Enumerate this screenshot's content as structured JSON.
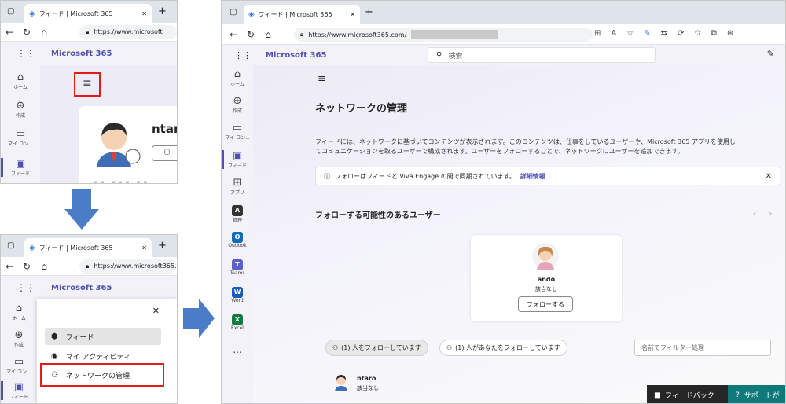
{
  "colors": {
    "accent": "#4f52b2",
    "highlight_box": "#e31b1b",
    "arrow": "#4a7cc7",
    "teams": "#5b5fc7",
    "outlook": "#0f6cbd",
    "word": "#185abd",
    "excel": "#107c41"
  },
  "browser": {
    "tab_title": "フィード | Microsoft 365",
    "url_prefix": "https://",
    "url_short": "www.microsoft",
    "url_mid": "www.microsoft365.c",
    "url_full": "www.microsoft365.com/"
  },
  "app": {
    "brand": "Microsoft 365",
    "search_placeholder": "検索"
  },
  "rail": {
    "home": "ホーム",
    "create": "作成",
    "mycontent_short": "マイ コン...",
    "mycontent": "マイ コン...",
    "feed": "フィード",
    "apps": "アプリ",
    "admin": "管理",
    "outlook": "Outlook",
    "teams": "Teams",
    "word": "Word",
    "excel": "Excel",
    "more": "..."
  },
  "panel1": {
    "profile_name": "ntar"
  },
  "panel2": {
    "menu_items": [
      {
        "label": "フィード"
      },
      {
        "label": "マイ アクティビティ"
      },
      {
        "label": "ネットワークの管理"
      }
    ]
  },
  "main": {
    "title": "ネットワークの管理",
    "description_line1": "フィードには、ネットワークに基づいてコンテンツが表示されます。このコンテンツは、仕事をしているユーザーや、Microsoft 365 アプリを使用し",
    "description_line2": "てコミュニケーションを取るユーザーで構成されます。ユーザーをフォローすることで、ネットワークにユーザーを追加できます。",
    "info_text": "フォローはフィードと Viva Engage の間で同期されています。",
    "info_link": "詳細情報",
    "suggestions_title": "フォローする可能性のあるユーザー",
    "suggestion": {
      "name": "ando",
      "subtitle": "該当なし",
      "follow_label": "フォローする"
    },
    "following_chip": "(1) 人をフォローしています",
    "followers_chip": "(1) 人があなたをフォローしています",
    "filter_placeholder": "名前でフィルター処理",
    "following_user": {
      "name": "ntaro",
      "subtitle": "該当なし"
    },
    "feedback_label": "フィードバック",
    "support_label": "サポートが"
  }
}
